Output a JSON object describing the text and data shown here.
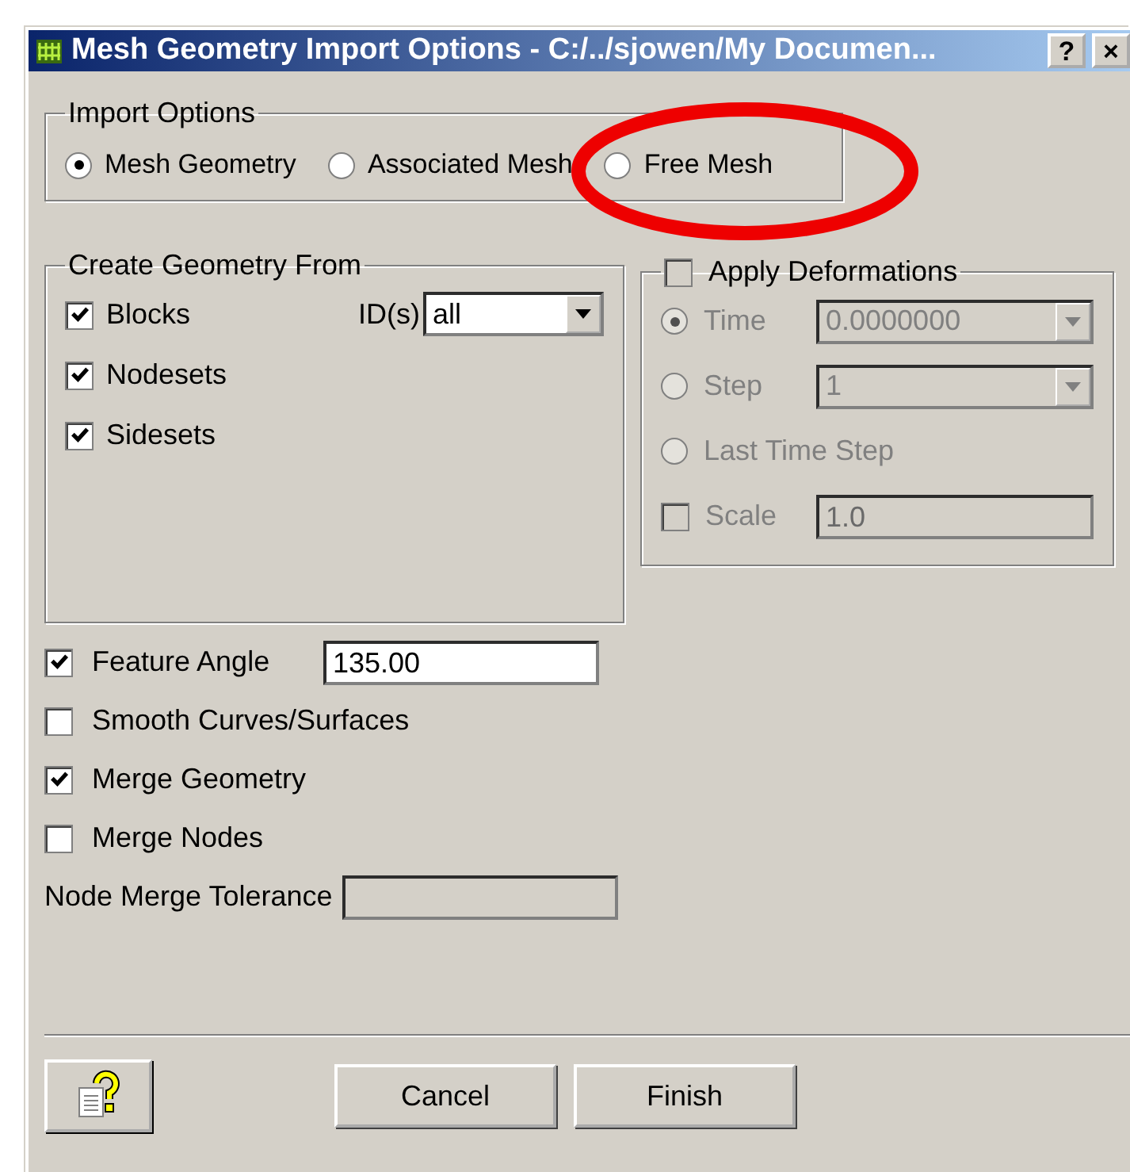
{
  "window": {
    "title": "Mesh Geometry Import Options - C:/../sjowen/My Documen...",
    "buttons": [
      "?",
      "×"
    ]
  },
  "import_options": {
    "label": "Import Options",
    "options": [
      {
        "label": "Mesh Geometry",
        "selected": true
      },
      {
        "label": "Associated Mesh",
        "selected": false
      },
      {
        "label": "Free Mesh",
        "selected": false
      }
    ]
  },
  "create_geometry": {
    "label": "Create Geometry From",
    "items": [
      {
        "label": "Blocks",
        "checked": true
      },
      {
        "label": "Nodesets",
        "checked": true
      },
      {
        "label": "Sidesets",
        "checked": true
      }
    ],
    "ids": {
      "label": "ID(s)",
      "value": "all"
    }
  },
  "deformations": {
    "label": "Apply Deformations",
    "checked": false,
    "disabled": true,
    "rows": [
      {
        "kind": "radio",
        "label": "Time",
        "selected": true,
        "field": {
          "kind": "dropdown",
          "value": "0.0000000"
        }
      },
      {
        "kind": "radio",
        "label": "Step",
        "selected": false,
        "field": {
          "kind": "dropdown",
          "value": "1"
        }
      },
      {
        "kind": "radio",
        "label": "Last Time Step",
        "selected": false
      },
      {
        "kind": "checkbox",
        "label": "Scale",
        "checked": false,
        "field": {
          "kind": "text",
          "value": "1.0"
        }
      }
    ]
  },
  "options": [
    {
      "kind": "checkbox",
      "label": "Feature Angle",
      "checked": true,
      "field": {
        "value": "135.00",
        "disabled": false
      }
    },
    {
      "kind": "checkbox",
      "label": "Smooth Curves/Surfaces",
      "checked": false
    },
    {
      "kind": "checkbox",
      "label": "Merge Geometry",
      "checked": true
    },
    {
      "kind": "checkbox",
      "label": "Merge Nodes",
      "checked": false
    },
    {
      "kind": "field",
      "label": "Node Merge Tolerance",
      "field": {
        "disabled": true
      }
    }
  ],
  "buttons": [
    "Cancel",
    "Finish"
  ]
}
